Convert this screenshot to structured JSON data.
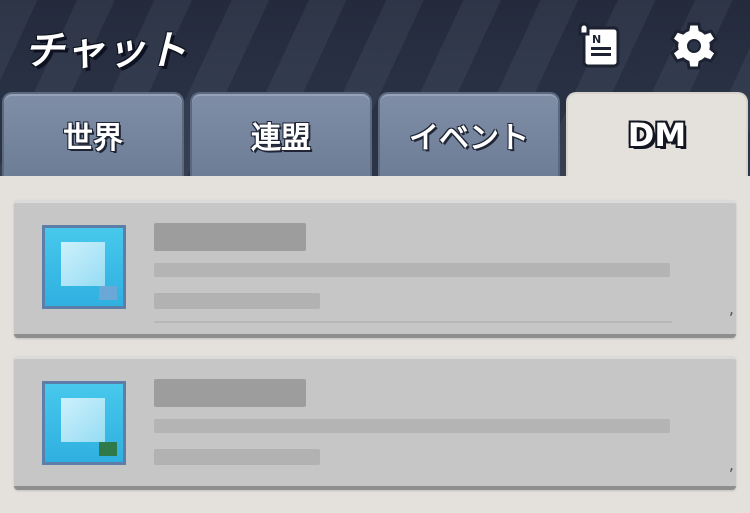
{
  "header": {
    "title": "チャット",
    "icons": [
      "notice-scroll-icon",
      "gear-icon"
    ]
  },
  "tabs": [
    {
      "label": "世界",
      "active": false
    },
    {
      "label": "連盟",
      "active": false
    },
    {
      "label": "イベント",
      "active": false
    },
    {
      "label": "DM",
      "active": true
    }
  ],
  "dm_list": [
    {
      "avatar_icon": "user-avatar-icon"
    },
    {
      "avatar_icon": "user-avatar-icon"
    }
  ],
  "colors": {
    "header_bg": "#2b3448",
    "tab_inactive": "#7485a0",
    "tab_active": "#e4e1dc",
    "list_bg": "#e4e1dc",
    "item_bg": "#c6c6c6"
  }
}
